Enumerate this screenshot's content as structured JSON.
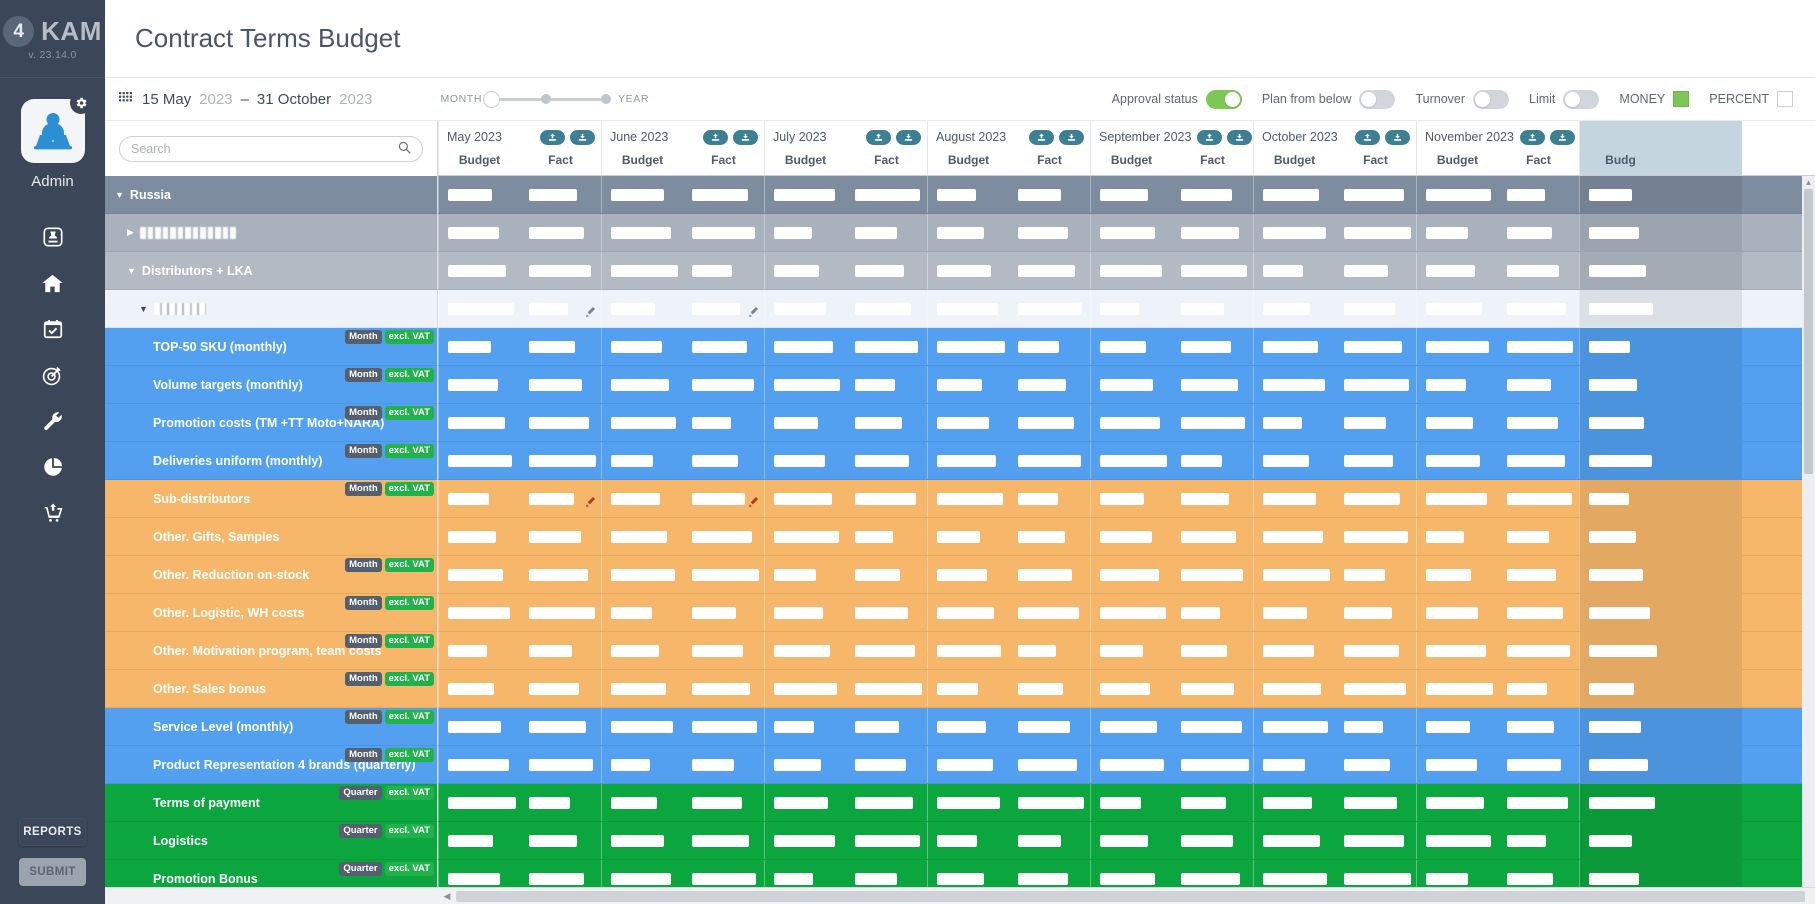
{
  "sidebar": {
    "brand": {
      "mark": "4",
      "name": "KAM",
      "version": "v. 23.14.0"
    },
    "user": {
      "name": "Admin",
      "avatar_icon": "user-laptop-avatar-icon",
      "gear_icon": "gear-icon"
    },
    "nav_items": [
      {
        "name": "sidebar-item-documents",
        "icon": "document-stamp-icon"
      },
      {
        "name": "sidebar-item-home",
        "icon": "home-icon"
      },
      {
        "name": "sidebar-item-calendar",
        "icon": "calendar-check-icon"
      },
      {
        "name": "sidebar-item-targets",
        "icon": "target-dart-icon"
      },
      {
        "name": "sidebar-item-settings",
        "icon": "wrench-icon"
      },
      {
        "name": "sidebar-item-analytics",
        "icon": "pie-chart-icon"
      },
      {
        "name": "sidebar-item-upload-cart",
        "icon": "cart-upload-icon"
      }
    ],
    "reports_label": "REPORTS",
    "submit_label": "SUBMIT"
  },
  "header": {
    "title": "Contract Terms Budget"
  },
  "toolbar": {
    "calendar_icon": "grid-calendar-icon",
    "date_start_day": "15 May",
    "date_start_year": "2023",
    "date_sep": "–",
    "date_end_day": "31 October",
    "date_end_year": "2023",
    "slider": {
      "left_label": "MONTH",
      "right_label": "YEAR"
    },
    "toggles": [
      {
        "label": "Approval status",
        "on": true
      },
      {
        "label": "Plan from below",
        "on": false
      },
      {
        "label": "Turnover",
        "on": false
      },
      {
        "label": "Limit",
        "on": false
      }
    ],
    "money_label": "MONEY",
    "money_checked": true,
    "percent_label": "PERCENT",
    "percent_checked": false,
    "accent_green": "#7dc855",
    "accent_teal": "#3d7f93"
  },
  "search": {
    "placeholder": "Search",
    "value": "",
    "icon": "search-icon"
  },
  "columns": [
    {
      "month": "May 2023",
      "sub": [
        "Budget",
        "Fact"
      ],
      "upload_icon": "upload-icon",
      "download_icon": "download-icon"
    },
    {
      "month": "June 2023",
      "sub": [
        "Budget",
        "Fact"
      ],
      "upload_icon": "upload-icon",
      "download_icon": "download-icon"
    },
    {
      "month": "July 2023",
      "sub": [
        "Budget",
        "Fact"
      ],
      "upload_icon": "upload-icon",
      "download_icon": "download-icon"
    },
    {
      "month": "August 2023",
      "sub": [
        "Budget",
        "Fact"
      ],
      "upload_icon": "upload-icon",
      "download_icon": "download-icon"
    },
    {
      "month": "September 2023",
      "sub": [
        "Budget",
        "Fact"
      ],
      "upload_icon": "upload-icon",
      "download_icon": "download-icon"
    },
    {
      "month": "October 2023",
      "sub": [
        "Budget",
        "Fact"
      ],
      "upload_icon": "upload-icon",
      "download_icon": "download-icon"
    },
    {
      "month": "November 2023",
      "sub": [
        "Budget",
        "Fact"
      ],
      "upload_icon": "upload-icon",
      "download_icon": "download-icon"
    },
    {
      "month": "",
      "sub": [
        "Budg",
        ""
      ],
      "partial": true
    }
  ],
  "rows": [
    {
      "label": "Russia",
      "theme": "r-t0",
      "indent": 0,
      "expanded": true,
      "caret": "down",
      "redacted": false,
      "badges": []
    },
    {
      "label": "",
      "theme": "r-t1",
      "indent": 1,
      "expanded": false,
      "caret": "right",
      "redacted": true,
      "redact_width": 96,
      "badges": []
    },
    {
      "label": "Distributors + LKA",
      "theme": "r-t2",
      "indent": 1,
      "expanded": true,
      "caret": "down",
      "redacted": false,
      "badges": []
    },
    {
      "label": "",
      "theme": "r-t3",
      "indent": 2,
      "expanded": true,
      "caret": "down",
      "redacted": true,
      "redact_width": 52,
      "badges": []
    },
    {
      "label": "TOP-50 SKU (monthly)",
      "theme": "r-blue",
      "indent": 3,
      "badges": [
        "Month",
        "excl. VAT"
      ]
    },
    {
      "label": "Volume targets (monthly)",
      "theme": "r-blue",
      "indent": 3,
      "badges": [
        "Month",
        "excl. VAT"
      ]
    },
    {
      "label": "Promotion costs (TM +TT Moto+NARA)",
      "theme": "r-blue",
      "indent": 3,
      "badges": [
        "Month",
        "excl. VAT"
      ]
    },
    {
      "label": "Deliveries uniform (monthly)",
      "theme": "r-blue",
      "indent": 3,
      "badges": [
        "Month",
        "excl. VAT"
      ]
    },
    {
      "label": "Sub-distributors",
      "theme": "r-orange",
      "indent": 3,
      "badges": [
        "Month",
        "excl. VAT"
      ]
    },
    {
      "label": "Other. Gifts, Samples",
      "theme": "r-orange",
      "indent": 3,
      "badges": []
    },
    {
      "label": "Other. Reduction on-stock",
      "theme": "r-orange",
      "indent": 3,
      "badges": [
        "Month",
        "excl. VAT"
      ]
    },
    {
      "label": "Other. Logistic, WH costs",
      "theme": "r-orange",
      "indent": 3,
      "badges": [
        "Month",
        "excl. VAT"
      ]
    },
    {
      "label": "Other. Motivation program, team costs",
      "theme": "r-orange",
      "indent": 3,
      "badges": [
        "Month",
        "excl. VAT"
      ]
    },
    {
      "label": "Other. Sales bonus",
      "theme": "r-orange",
      "indent": 3,
      "badges": [
        "Month",
        "excl. VAT"
      ]
    },
    {
      "label": "Service Level (monthly)",
      "theme": "r-blue",
      "indent": 3,
      "badges": [
        "Month",
        "excl. VAT"
      ]
    },
    {
      "label": "Product Representation 4 brands (quarterly)",
      "theme": "r-blue",
      "indent": 3,
      "badges": [
        "Month",
        "excl. VAT"
      ]
    },
    {
      "label": "Terms of payment",
      "theme": "r-green",
      "indent": 3,
      "badges": [
        "Quarter",
        "excl. VAT"
      ]
    },
    {
      "label": "Logistics",
      "theme": "r-green",
      "indent": 3,
      "badges": [
        "Quarter",
        "excl. VAT"
      ]
    },
    {
      "label": "Promotion Bonus",
      "theme": "r-green",
      "indent": 3,
      "badges": [
        "Quarter",
        "excl. VAT"
      ]
    }
  ],
  "cells_note": "All numeric budget / fact values in the grid are redacted (white blocks).",
  "edit_icon": "pencil-edit-icon",
  "scrollbars": {
    "h_left_arrow": "chevron-left-icon",
    "v_up_arrow": "chevron-up-icon"
  }
}
